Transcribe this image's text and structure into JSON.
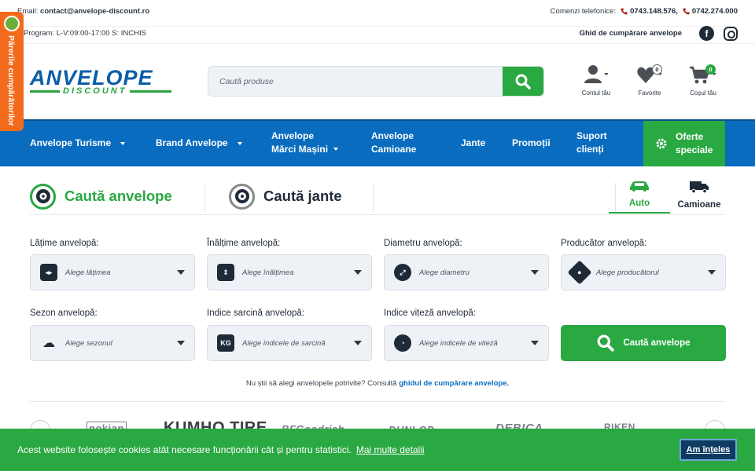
{
  "topbar": {
    "email_label": "Email:",
    "email": "contact@anvelope-discount.ro",
    "program_label": "Program:",
    "program": "L-V:09:00-17:00 S: INCHIS",
    "phone_label": "Comenzi telefonice:",
    "phone1": "0743.148.576,",
    "phone2": "0742.274.000",
    "guide_link": "Ghid de cumpărare anvelope",
    "facebook_icon": "facebook-icon",
    "instagram_icon": "instagram-icon"
  },
  "side_tab": {
    "label": "Părerile cumpărătorilor"
  },
  "logo": {
    "line1": "ANVELOPE",
    "line2": "DISCOUNT"
  },
  "search": {
    "placeholder": "Caută produse"
  },
  "header_icons": [
    {
      "label": "Contul tău",
      "icon": "user-icon"
    },
    {
      "label": "Favorite",
      "icon": "heart-icon",
      "count": "0"
    },
    {
      "label": "Coșul tău",
      "icon": "cart-icon",
      "count": "0"
    }
  ],
  "nav": {
    "items": [
      {
        "label": "Anvelope Turisme"
      },
      {
        "label": "Brand Anvelope"
      },
      {
        "label_line1": "Anvelope",
        "label_line2": "Mărci Mașini"
      },
      {
        "label_line1": "Anvelope",
        "label_line2": "Camioane"
      },
      {
        "label": "Jante"
      },
      {
        "label": "Promoții"
      },
      {
        "label_line1": "Suport",
        "label_line2": "clienți"
      }
    ],
    "offer_line1": "Oferte",
    "offer_line2": "speciale"
  },
  "search_tabs": {
    "tires": "Caută anvelope",
    "rims": "Caută jante",
    "auto": "Auto",
    "trucks": "Camioane"
  },
  "filters": {
    "width_label": "Lățime anvelopă:",
    "width_ph": "Alege lățimea",
    "height_label": "Înălțime anvelopă:",
    "height_ph": "Alege înălțimea",
    "diameter_label": "Diametru anvelopă:",
    "diameter_ph": "Alege diametru",
    "brand_label": "Producător anvelopă:",
    "brand_ph": "Alege producătorul",
    "season_label": "Sezon anvelopă:",
    "season_ph": "Alege sezonul",
    "load_label": "Indice sarcină anvelopă:",
    "load_ph": "Alege indicele de sarcină",
    "speed_label": "Indice viteză anvelopă:",
    "speed_ph": "Alege indicele de viteză",
    "search_button": "Caută anvelope"
  },
  "help": {
    "text": "Nu știi să alegi anvelopele potrivite? Consultă ",
    "link": "ghidul de cumpărare anvelope."
  },
  "brands": [
    "nokian",
    "KUMHO TIRE",
    "BFGoodrich",
    "DUNLOP",
    "DEBICA",
    "RIKEN"
  ],
  "cookie": {
    "text": "Acest website folosește cookies atât necesare funcționării cât și pentru statistici.",
    "more": "Mai multe detalii",
    "accept": "Am înțeles"
  },
  "colors": {
    "primary": "#0a6cbf",
    "accent": "#2aa842",
    "side_tab": "#f26b1d"
  }
}
